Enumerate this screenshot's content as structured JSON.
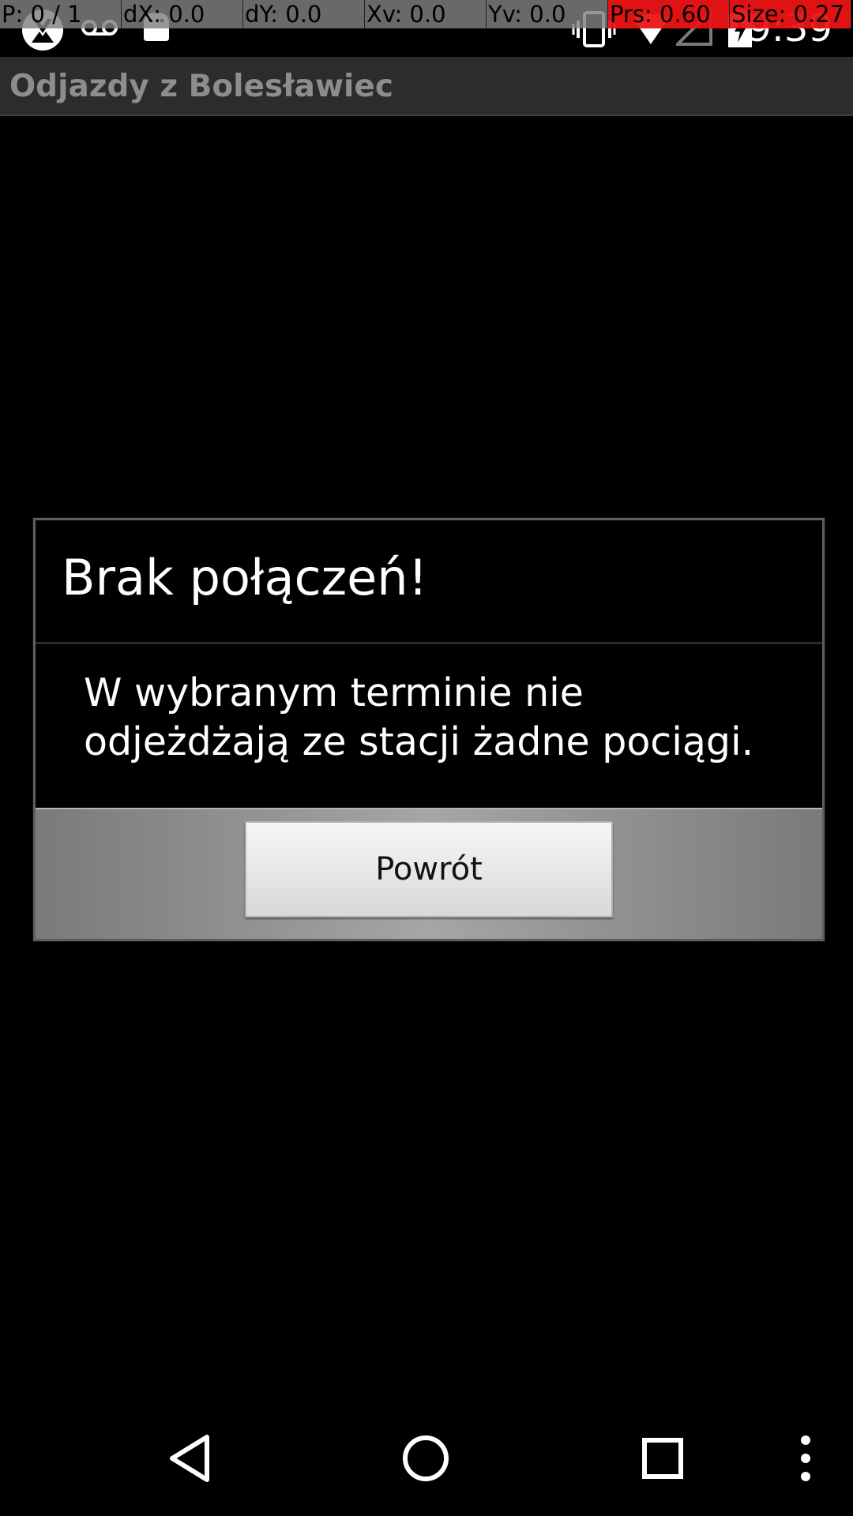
{
  "status_bar": {
    "time": "9:39",
    "icons": [
      "app-notification-icon",
      "voicemail-icon",
      "android-notification-icon",
      "vibrate-icon",
      "wifi-icon",
      "cell-signal-icon",
      "battery-charging-icon"
    ]
  },
  "pointer_overlay": {
    "cells": [
      "P: 0 / 1",
      "dX: 0.0",
      "dY: 0.0",
      "Xv: 0.0",
      "Yv: 0.0",
      "Prs: 0.60",
      "Size: 0.27"
    ],
    "highlight_color": "#eb1414"
  },
  "app": {
    "title": "Odjazdy z Bolesławiec"
  },
  "dialog": {
    "title": "Brak połączeń!",
    "message": "W wybranym terminie nie odjeżdżają ze stacji żadne pociągi.",
    "button_label": "Powrót"
  },
  "nav_bar": {
    "icons": [
      "back-icon",
      "home-icon",
      "recents-icon",
      "overflow-menu-icon"
    ]
  }
}
